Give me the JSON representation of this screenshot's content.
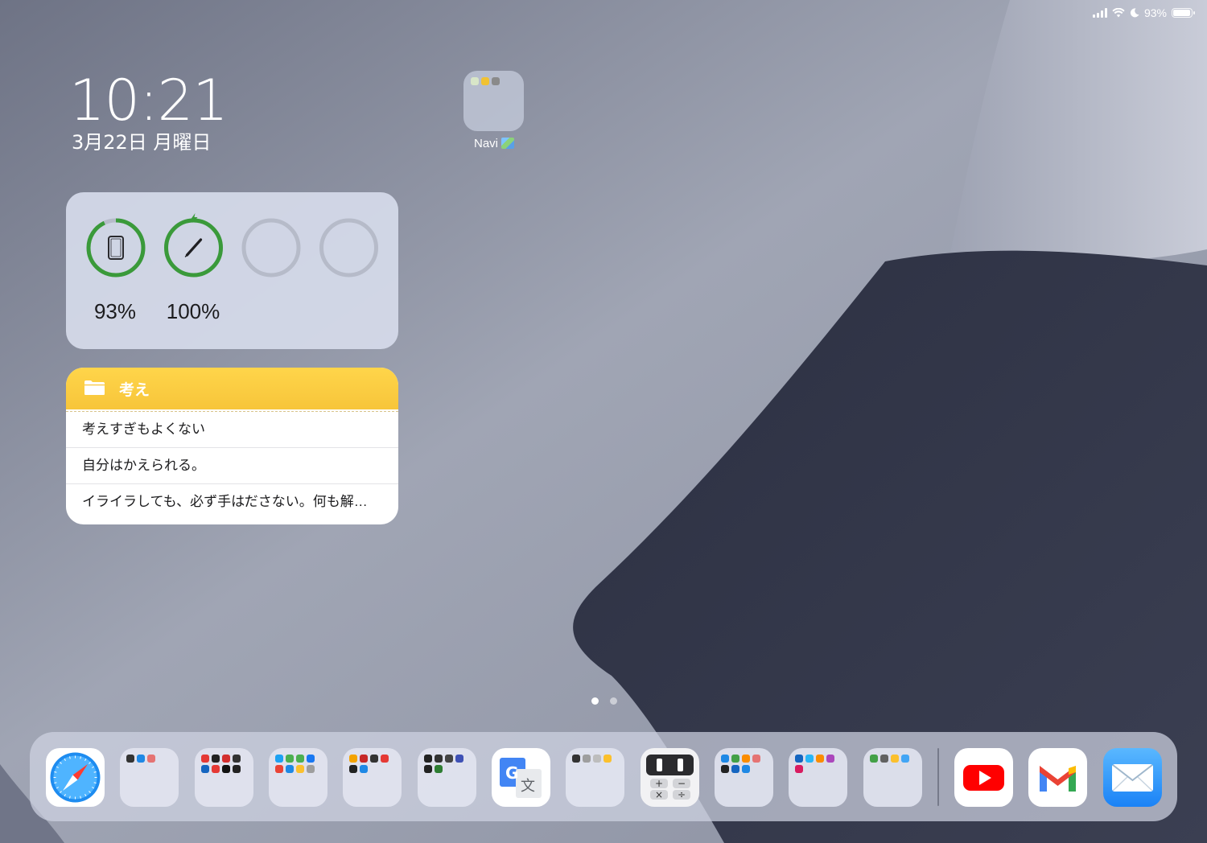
{
  "status_bar": {
    "battery_text": "93%"
  },
  "clock": {
    "time": "10:21",
    "date": "3月22日 月曜日"
  },
  "home_folder": {
    "label": "Navi",
    "mini_icon_colors": [
      "#d8e6c8",
      "#f1c232",
      "#8a8a8a"
    ]
  },
  "battery_widget": {
    "devices": [
      {
        "name": "ipad",
        "icon": "tablet-icon",
        "level": 0.93,
        "label": "93%",
        "ring_color": "#3a9a3a"
      },
      {
        "name": "pencil",
        "icon": "pencil-icon",
        "level": 1.0,
        "label": "100%",
        "ring_color": "#3a9a3a",
        "charging": true
      },
      {
        "name": "empty-1",
        "level": 0,
        "label": ""
      },
      {
        "name": "empty-2",
        "level": 0,
        "label": ""
      }
    ]
  },
  "notes_widget": {
    "folder": "考え",
    "notes": [
      "考えすぎもよくない",
      "自分はかえられる。",
      "イライラしても、必ず手はださない。何も解…"
    ]
  },
  "page_dots": {
    "count": 2,
    "active": 0
  },
  "dock": {
    "apps": [
      {
        "name": "safari",
        "icon": "safari-icon"
      },
      {
        "name": "folder-1",
        "minis": [
          "#333333",
          "#1e88e5",
          "#e57373"
        ]
      },
      {
        "name": "folder-2",
        "minis": [
          "#e53935",
          "#222222",
          "#d32f2f",
          "#333333",
          "#1565c0",
          "#e53935",
          "#111111",
          "#222222"
        ]
      },
      {
        "name": "folder-3",
        "minis": [
          "#1da1f2",
          "#4caf50",
          "#4caf50",
          "#1877f2",
          "#ea4335",
          "#1e88e5",
          "#fbc02d",
          "#9e9e9e"
        ]
      },
      {
        "name": "folder-4",
        "minis": [
          "#f4a300",
          "#c62828",
          "#333333",
          "#e53935",
          "#222222",
          "#1e88e5"
        ]
      },
      {
        "name": "folder-5",
        "minis": [
          "#222222",
          "#333333",
          "#444444",
          "#3f51b5",
          "#222222",
          "#2e7d32"
        ]
      },
      {
        "name": "google-translate",
        "icon": "translate-icon"
      },
      {
        "name": "folder-6",
        "minis": [
          "#333333",
          "#9e9e9e",
          "#bdbdbd",
          "#fbc02d"
        ]
      },
      {
        "name": "calculator",
        "icon": "calculator-icon"
      },
      {
        "name": "folder-7",
        "minis": [
          "#1e88e5",
          "#43a047",
          "#fb8c00",
          "#e57373",
          "#222222",
          "#1565c0",
          "#1e88e5"
        ]
      },
      {
        "name": "folder-8",
        "minis": [
          "#1565c0",
          "#29b6f6",
          "#fb8c00",
          "#ab47bc",
          "#d81b60"
        ]
      },
      {
        "name": "folder-9",
        "minis": [
          "#43a047",
          "#616161",
          "#fbc02d",
          "#42a5f5"
        ]
      },
      {
        "name": "youtube",
        "icon": "youtube-icon"
      },
      {
        "name": "gmail",
        "icon": "gmail-icon"
      },
      {
        "name": "mail",
        "icon": "mail-icon"
      }
    ]
  }
}
